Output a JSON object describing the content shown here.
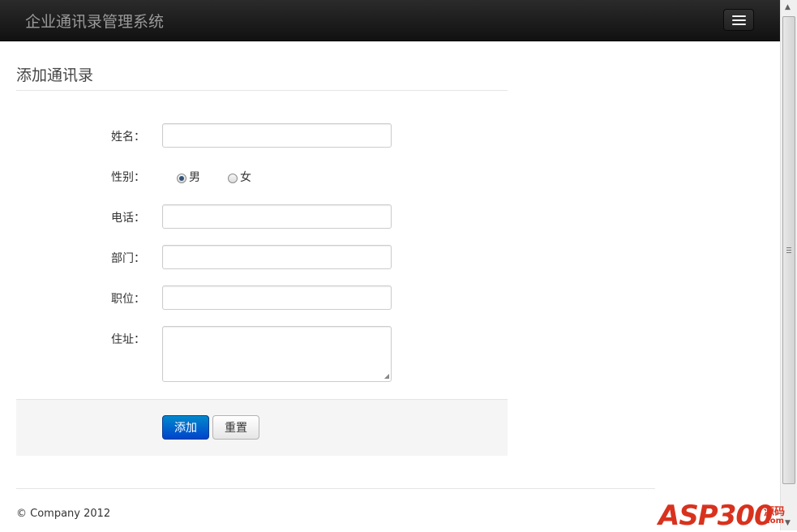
{
  "navbar": {
    "brand": "企业通讯录管理系统",
    "menu_icon": "hamburger-menu-icon"
  },
  "page": {
    "title": "添加通讯录"
  },
  "form": {
    "name_label": "姓名：",
    "name_value": "",
    "gender_label": "性别：",
    "gender_options": [
      {
        "label": "男",
        "checked": true
      },
      {
        "label": "女",
        "checked": false
      }
    ],
    "phone_label": "电话：",
    "phone_value": "",
    "department_label": "部门：",
    "department_value": "",
    "position_label": "职位：",
    "position_value": "",
    "address_label": "住址：",
    "address_value": ""
  },
  "actions": {
    "submit_label": "添加",
    "reset_label": "重置"
  },
  "footer": {
    "text": "© Company 2012"
  },
  "watermark": {
    "brand": "ASP300",
    "sub1": "源码",
    "sub2": ".com"
  },
  "colors": {
    "navbar": "#1b1b1b",
    "primary": "#0066cc",
    "brand_text": "#9a9a9a",
    "watermark": "#d8321e"
  }
}
